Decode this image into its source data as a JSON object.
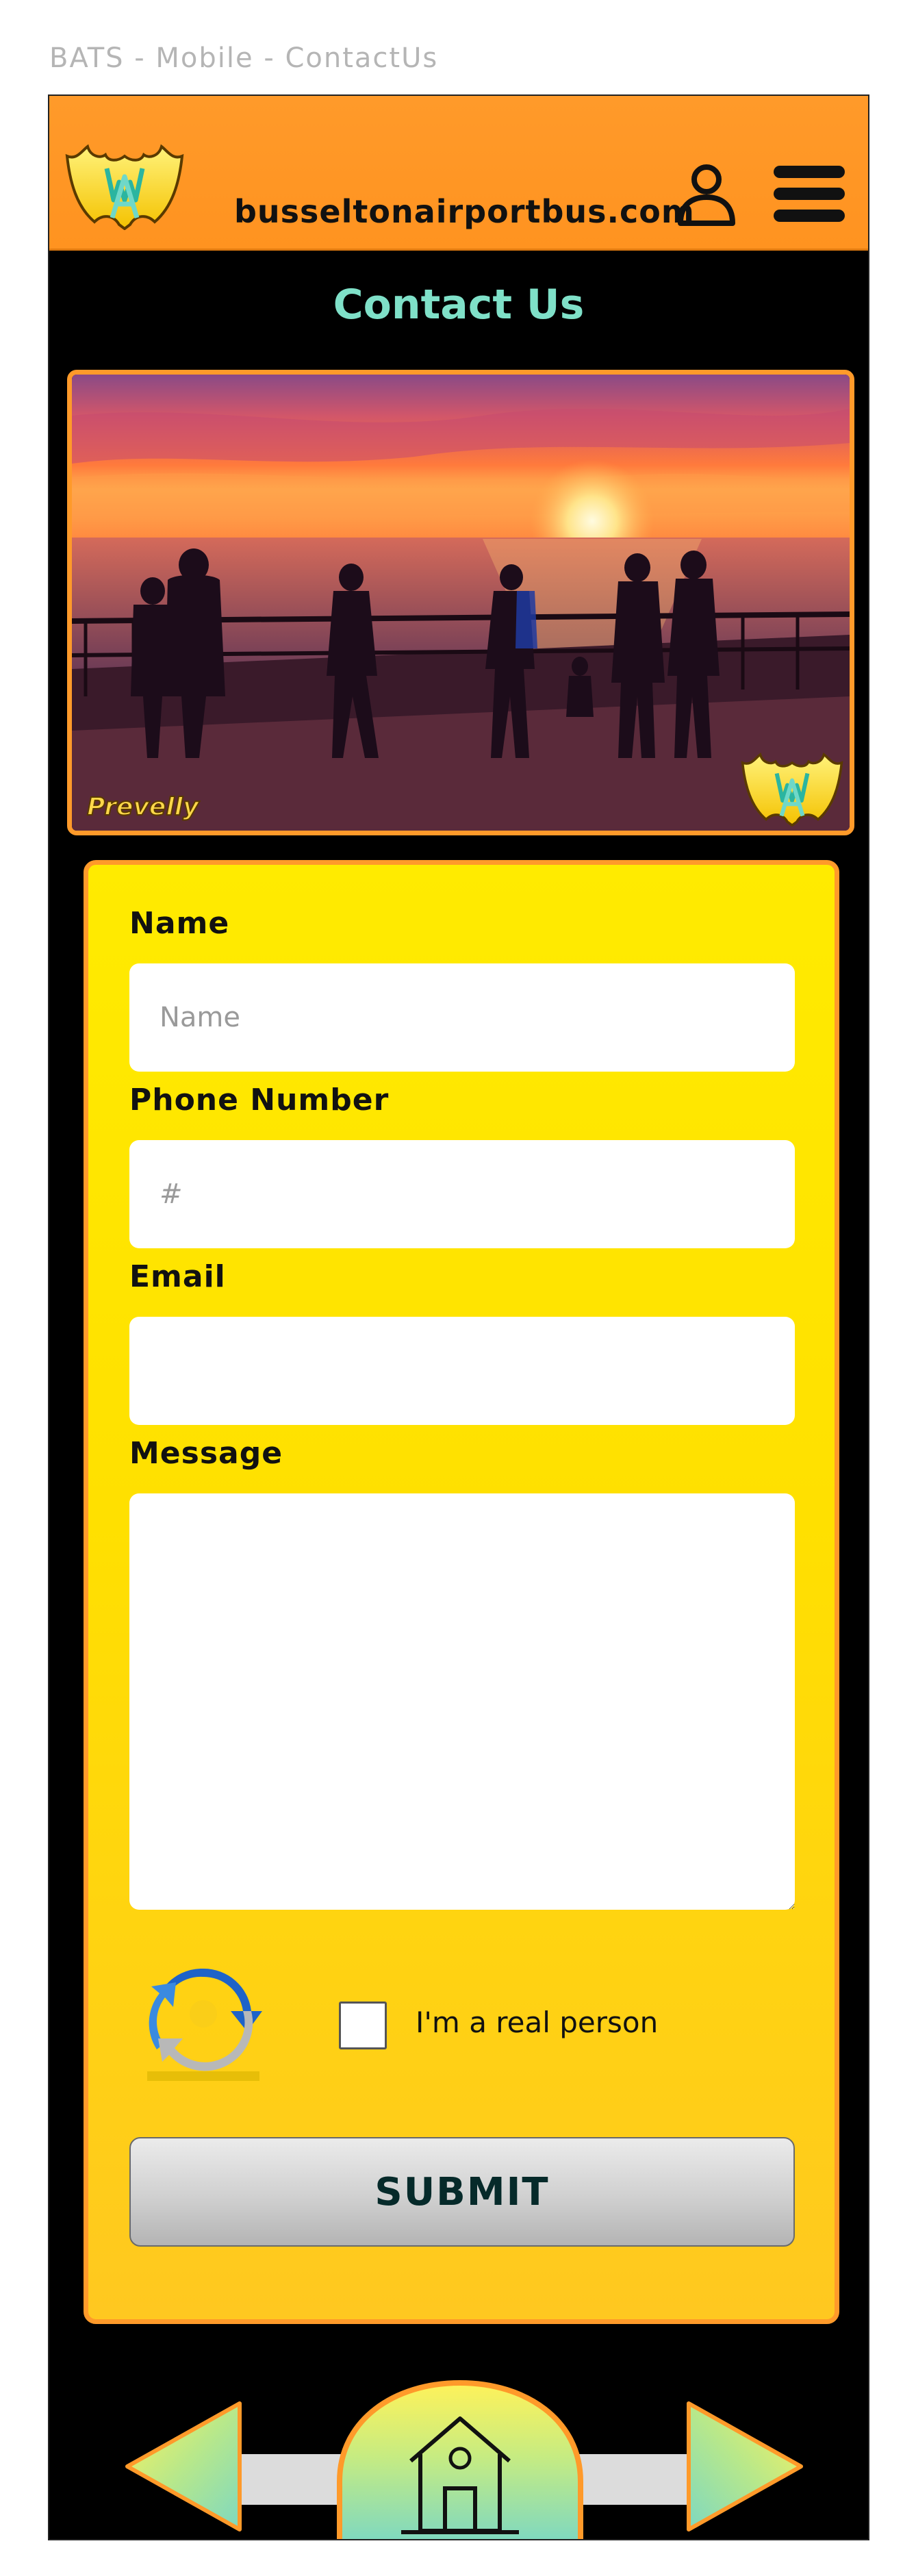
{
  "page": {
    "caption": "BATS - Mobile - ContactUs"
  },
  "header": {
    "site_name": "busseltonairportbus.com",
    "logo_icon": "bats-logo-icon",
    "user_icon": "user-icon",
    "menu_icon": "hamburger-menu-icon",
    "accent_color": "#ff9a2a"
  },
  "main": {
    "title": "Contact Us",
    "title_color": "#7fe0c8",
    "hero": {
      "caption": "Prevelly",
      "badge_icon": "bats-logo-icon"
    }
  },
  "form": {
    "name": {
      "label": "Name",
      "placeholder": "Name",
      "value": ""
    },
    "phone": {
      "label": "Phone Number",
      "placeholder": "#",
      "value": ""
    },
    "email": {
      "label": "Email",
      "placeholder": "",
      "value": ""
    },
    "message": {
      "label": "Message",
      "placeholder": "",
      "value": ""
    },
    "captcha": {
      "label": "I'm a real person",
      "checked": false,
      "logo_icon": "recaptcha-icon"
    },
    "submit_label": "SUBMIT",
    "background_color": "#ffe000"
  },
  "bottom_nav": {
    "prev_icon": "arrow-left-icon",
    "home_icon": "home-icon",
    "next_icon": "arrow-right-icon"
  }
}
